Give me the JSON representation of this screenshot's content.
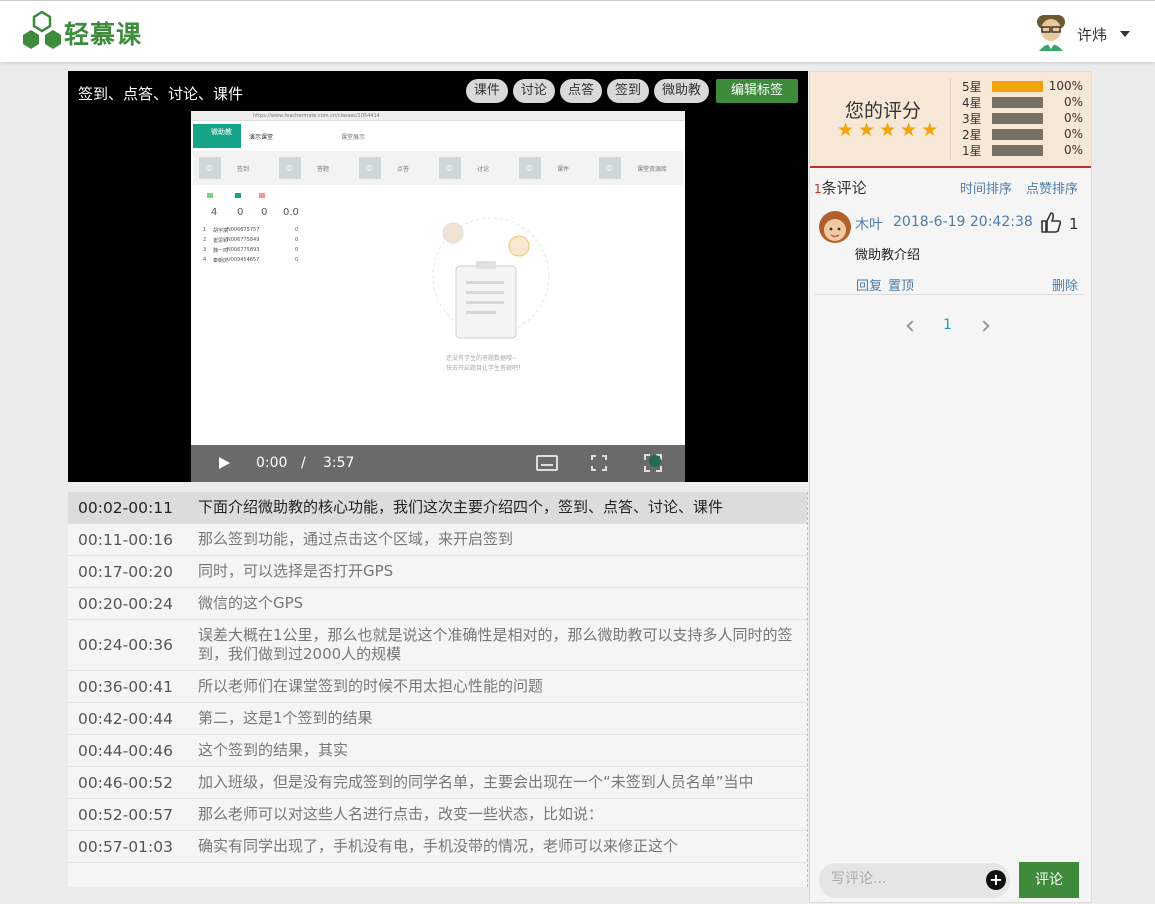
{
  "header": {
    "brand": "轻慕课",
    "user_name": "许炜"
  },
  "video": {
    "title": "签到、点答、讨论、课件",
    "tags": [
      "课件",
      "讨论",
      "点答",
      "签到",
      "微助教"
    ],
    "edit_tags_label": "编辑标签",
    "current_time": "0:00",
    "separator": "/",
    "duration": "3:57",
    "inner_screen": {
      "app_name": "微助教",
      "class_name": "演示课堂",
      "url": "https://www.teachermate.com.cn/classes/1054414",
      "menu": "课堂展示",
      "tiles": [
        {
          "count": "0",
          "label": "签到"
        },
        {
          "count": "0",
          "label": "答题"
        },
        {
          "count": "0",
          "label": "点答"
        },
        {
          "count": "0",
          "label": "讨论"
        },
        {
          "count": "0",
          "label": "课件"
        },
        {
          "count": "0",
          "label": "课堂资源库"
        }
      ],
      "stats_numbers": [
        "4",
        "0",
        "0",
        "0.0"
      ],
      "students": [
        {
          "idx": "1",
          "name": "胡宇斌",
          "id": "N006675757",
          "score": "0"
        },
        {
          "idx": "2",
          "name": "崔思颖",
          "id": "N006775849",
          "score": "0"
        },
        {
          "idx": "3",
          "name": "魏一鸣",
          "id": "N006775893",
          "score": "0"
        },
        {
          "idx": "4",
          "name": "秦朝庆",
          "id": "U009454657",
          "score": "0"
        }
      ],
      "empty_line1": "还没有学生的答题数据哦~",
      "empty_line2": "快去开启题目让学生答题吧！"
    }
  },
  "transcript": [
    {
      "time": "00:02-00:11",
      "text": "下面介绍微助教的核心功能，我们这次主要介绍四个，签到、点答、讨论、课件",
      "active": true
    },
    {
      "time": "00:11-00:16",
      "text": "那么签到功能，通过点击这个区域，来开启签到"
    },
    {
      "time": "00:17-00:20",
      "text": "同时，可以选择是否打开GPS"
    },
    {
      "time": "00:20-00:24",
      "text": "微信的这个GPS"
    },
    {
      "time": "00:24-00:36",
      "text": "误差大概在1公里，那么也就是说这个准确性是相对的，那么微助教可以支持多人同时的签到，我们做到过2000人的规模"
    },
    {
      "time": "00:36-00:41",
      "text": "所以老师们在课堂签到的时候不用太担心性能的问题"
    },
    {
      "time": "00:42-00:44",
      "text": "第二，这是1个签到的结果"
    },
    {
      "time": "00:44-00:46",
      "text": "这个签到的结果，其实"
    },
    {
      "time": "00:46-00:52",
      "text": "加入班级，但是没有完成签到的同学名单，主要会出现在一个“未签到人员名单”当中"
    },
    {
      "time": "00:52-00:57",
      "text": "那么老师可以对这些人名进行点击，改变一些状态，比如说："
    },
    {
      "time": "00:57-01:03",
      "text": "确实有同学出现了，手机没有电，手机没带的情况，老师可以来修正这个"
    }
  ],
  "rating": {
    "label": "您的评分",
    "stars": 5,
    "distribution": [
      {
        "label": "5星",
        "percent": 100,
        "percent_text": "100%"
      },
      {
        "label": "4星",
        "percent": 0,
        "percent_text": "0%"
      },
      {
        "label": "3星",
        "percent": 0,
        "percent_text": "0%"
      },
      {
        "label": "2星",
        "percent": 0,
        "percent_text": "0%"
      },
      {
        "label": "1星",
        "percent": 0,
        "percent_text": "0%"
      }
    ]
  },
  "comments": {
    "count": "1",
    "count_suffix": "条评论",
    "sort_time": "时间排序",
    "sort_likes": "点赞排序",
    "items": [
      {
        "user": "木叶",
        "time": "2018-6-19 20:42:38",
        "likes": "1",
        "body": "微助教介绍",
        "reply": "回复",
        "pin": "置顶",
        "delete": "删除"
      }
    ],
    "current_page": "1",
    "input_placeholder": "写评论...",
    "submit_label": "评论"
  },
  "colors": {
    "brand_green": "#3f8b3c",
    "star_orange": "#f0a30a",
    "link_blue": "#4f7ba9",
    "accent_red": "#c32e26"
  }
}
